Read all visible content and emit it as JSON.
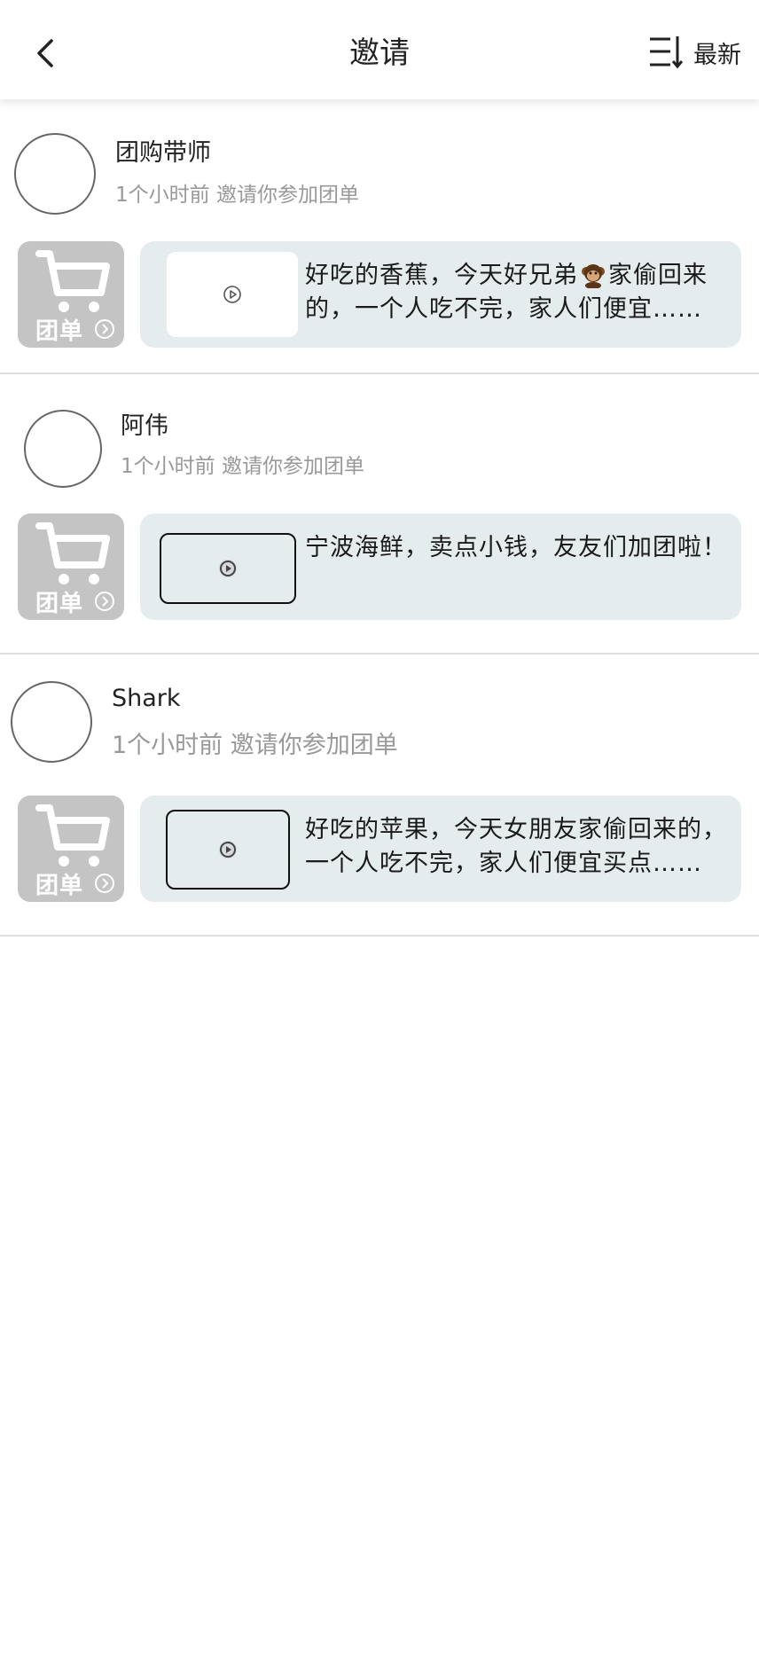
{
  "header": {
    "title": "邀请",
    "sort_label": "最新",
    "back_icon": "chevron-left-icon",
    "sort_icon": "sort-lines-icon"
  },
  "colors": {
    "tile_bg": "#c4c4c4",
    "content_bg": "#e5ecee",
    "meta_text": "#999999",
    "divider": "#dedede"
  },
  "invites": [
    {
      "user": "团购带师",
      "meta": "1个小时前 邀请你参加团单",
      "tile_label": "团单",
      "desc_line1_a": "好吃的香蕉，今天好兄弟",
      "desc_emoji": "monkey-emoji",
      "desc_line1_b": "家偷回来",
      "desc_line2": "的，一个人吃不完，家人们便宜……"
    },
    {
      "user": "阿伟",
      "meta": "1个小时前 邀请你参加团单",
      "tile_label": "团单",
      "desc_line1": "宁波海鲜，卖点小钱，友友们加团啦！"
    },
    {
      "user": "Shark",
      "meta": "1个小时前 邀请你参加团单",
      "tile_label": "团单",
      "desc_line1": "好吃的苹果，今天女朋友家偷回来的，",
      "desc_line2": "一个人吃不完，家人们便宜买点……"
    }
  ]
}
